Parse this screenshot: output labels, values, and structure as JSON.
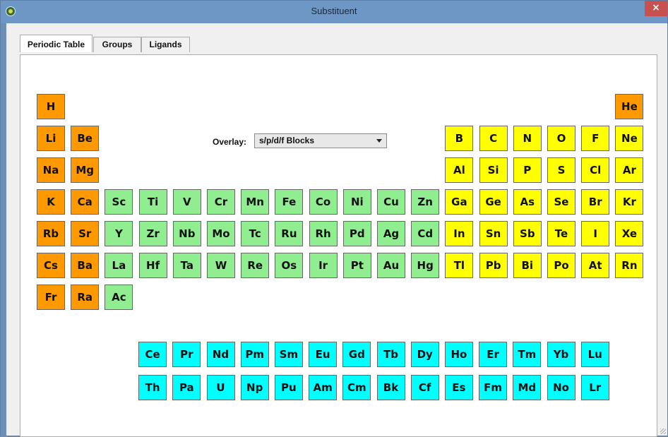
{
  "window": {
    "title": "Substituent",
    "close_label": "×"
  },
  "tabs": [
    {
      "label": "Periodic Table",
      "active": true
    },
    {
      "label": "Groups",
      "active": false
    },
    {
      "label": "Ligands",
      "active": false
    }
  ],
  "overlay": {
    "label": "Overlay:",
    "value": "s/p/d/f Blocks"
  },
  "colors": {
    "s_block": "#ff9900",
    "p_block": "#ffff00",
    "d_block": "#90ee90",
    "f_block": "#00ffff"
  },
  "main_table": [
    [
      "H",
      "",
      "",
      "",
      "",
      "",
      "",
      "",
      "",
      "",
      "",
      "",
      "",
      "",
      "",
      "",
      "",
      "He"
    ],
    [
      "Li",
      "Be",
      "",
      "",
      "",
      "",
      "",
      "",
      "",
      "",
      "",
      "",
      "B",
      "C",
      "N",
      "O",
      "F",
      "Ne"
    ],
    [
      "Na",
      "Mg",
      "",
      "",
      "",
      "",
      "",
      "",
      "",
      "",
      "",
      "",
      "Al",
      "Si",
      "P",
      "S",
      "Cl",
      "Ar"
    ],
    [
      "K",
      "Ca",
      "Sc",
      "Ti",
      "V",
      "Cr",
      "Mn",
      "Fe",
      "Co",
      "Ni",
      "Cu",
      "Zn",
      "Ga",
      "Ge",
      "As",
      "Se",
      "Br",
      "Kr"
    ],
    [
      "Rb",
      "Sr",
      "Y",
      "Zr",
      "Nb",
      "Mo",
      "Tc",
      "Ru",
      "Rh",
      "Pd",
      "Ag",
      "Cd",
      "In",
      "Sn",
      "Sb",
      "Te",
      "I",
      "Xe"
    ],
    [
      "Cs",
      "Ba",
      "La",
      "Hf",
      "Ta",
      "W",
      "Re",
      "Os",
      "Ir",
      "Pt",
      "Au",
      "Hg",
      "Tl",
      "Pb",
      "Bi",
      "Po",
      "At",
      "Rn"
    ],
    [
      "Fr",
      "Ra",
      "Ac",
      "",
      "",
      "",
      "",
      "",
      "",
      "",
      "",
      "",
      "",
      "",
      "",
      "",
      "",
      ""
    ]
  ],
  "f_block_rows": [
    [
      "Ce",
      "Pr",
      "Nd",
      "Pm",
      "Sm",
      "Eu",
      "Gd",
      "Tb",
      "Dy",
      "Ho",
      "Er",
      "Tm",
      "Yb",
      "Lu"
    ],
    [
      "Th",
      "Pa",
      "U",
      "Np",
      "Pu",
      "Am",
      "Cm",
      "Bk",
      "Cf",
      "Es",
      "Fm",
      "Md",
      "No",
      "Lr"
    ]
  ]
}
